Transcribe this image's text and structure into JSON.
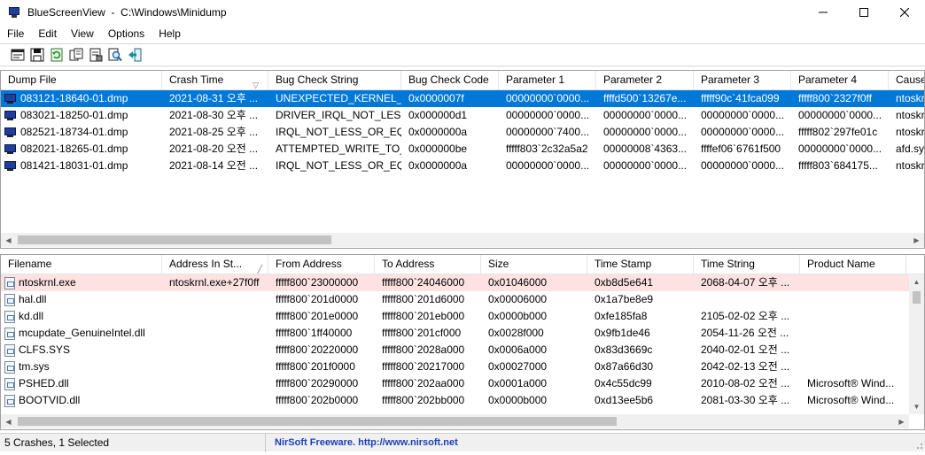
{
  "window": {
    "title": "BlueScreenView  -  C:\\Windows\\Minidump",
    "icon": "bluescreen-monitor-icon"
  },
  "menu": [
    "File",
    "Edit",
    "View",
    "Options",
    "Help"
  ],
  "toolbar": [
    "html-report-icon",
    "save-icon",
    "refresh-icon",
    "copy-icon",
    "properties-icon",
    "find-icon",
    "exit-icon"
  ],
  "crash_list": {
    "columns": [
      {
        "label": "Dump File"
      },
      {
        "label": "Crash Time",
        "sort": "desc"
      },
      {
        "label": "Bug Check String"
      },
      {
        "label": "Bug Check Code"
      },
      {
        "label": "Parameter 1"
      },
      {
        "label": "Parameter 2"
      },
      {
        "label": "Parameter 3"
      },
      {
        "label": "Parameter 4"
      },
      {
        "label": "Caused"
      }
    ],
    "rows": [
      {
        "selected": true,
        "cells": [
          "083121-18640-01.dmp",
          "2021-08-31 오후 ...",
          "UNEXPECTED_KERNEL_...",
          "0x0000007f",
          "00000000`0000...",
          "ffffd500`13267e...",
          "fffff90c`41fca099",
          "fffff800`2327f0ff",
          "ntoskrn"
        ]
      },
      {
        "selected": false,
        "cells": [
          "083021-18250-01.dmp",
          "2021-08-30 오후 ...",
          "DRIVER_IRQL_NOT_LES...",
          "0x000000d1",
          "00000000`0000...",
          "00000000`0000...",
          "00000000`0000...",
          "00000000`0000...",
          "ntoskrn"
        ]
      },
      {
        "selected": false,
        "cells": [
          "082521-18734-01.dmp",
          "2021-08-25 오후 ...",
          "IRQL_NOT_LESS_OR_EQ...",
          "0x0000000a",
          "00000000`7400...",
          "00000000`0000...",
          "00000000`0000...",
          "fffff802`297fe01c",
          "ntoskrn"
        ]
      },
      {
        "selected": false,
        "cells": [
          "082021-18265-01.dmp",
          "2021-08-20 오전 ...",
          "ATTEMPTED_WRITE_TO_...",
          "0x000000be",
          "fffff803`2c32a5a2",
          "00000008`4363...",
          "ffffef06`6761f500",
          "00000000`0000...",
          "afd.sys"
        ]
      },
      {
        "selected": false,
        "cells": [
          "081421-18031-01.dmp",
          "2021-08-14 오전 ...",
          "IRQL_NOT_LESS_OR_EQ...",
          "0x0000000a",
          "00000000`0000...",
          "00000000`0000...",
          "00000000`0000...",
          "fffff803`684175...",
          "ntoskrn"
        ]
      }
    ]
  },
  "driver_list": {
    "columns": [
      {
        "label": "Filename"
      },
      {
        "label": "Address In St...",
        "sort": "asc"
      },
      {
        "label": "From Address"
      },
      {
        "label": "To Address"
      },
      {
        "label": "Size"
      },
      {
        "label": "Time Stamp"
      },
      {
        "label": "Time String"
      },
      {
        "label": "Product Name"
      }
    ],
    "rows": [
      {
        "highlight": true,
        "cells": [
          "ntoskrnl.exe",
          "ntoskrnl.exe+27f0ff",
          "fffff800`23000000",
          "fffff800`24046000",
          "0x01046000",
          "0xb8d5e641",
          "2068-04-07 오후 ...",
          ""
        ]
      },
      {
        "highlight": false,
        "cells": [
          "hal.dll",
          "",
          "fffff800`201d0000",
          "fffff800`201d6000",
          "0x00006000",
          "0x1a7be8e9",
          "",
          ""
        ]
      },
      {
        "highlight": false,
        "cells": [
          "kd.dll",
          "",
          "fffff800`201e0000",
          "fffff800`201eb000",
          "0x0000b000",
          "0xfe185fa8",
          "2105-02-02 오후 ...",
          ""
        ]
      },
      {
        "highlight": false,
        "cells": [
          "mcupdate_GenuineIntel.dll",
          "",
          "fffff800`1ff40000",
          "fffff800`201cf000",
          "0x0028f000",
          "0x9fb1de46",
          "2054-11-26 오전 ...",
          ""
        ]
      },
      {
        "highlight": false,
        "cells": [
          "CLFS.SYS",
          "",
          "fffff800`20220000",
          "fffff800`2028a000",
          "0x0006a000",
          "0x83d3669c",
          "2040-02-01 오전 ...",
          ""
        ]
      },
      {
        "highlight": false,
        "cells": [
          "tm.sys",
          "",
          "fffff800`201f0000",
          "fffff800`20217000",
          "0x00027000",
          "0x87a66d30",
          "2042-02-13 오전 ...",
          ""
        ]
      },
      {
        "highlight": false,
        "cells": [
          "PSHED.dll",
          "",
          "fffff800`20290000",
          "fffff800`202aa000",
          "0x0001a000",
          "0x4c55dc99",
          "2010-08-02 오전 ...",
          "Microsoft® Wind..."
        ]
      },
      {
        "highlight": false,
        "cells": [
          "BOOTVID.dll",
          "",
          "fffff800`202b0000",
          "fffff800`202bb000",
          "0x0000b000",
          "0xd13ee5b6",
          "2081-03-30 오후 ...",
          "Microsoft® Wind..."
        ]
      }
    ]
  },
  "status": {
    "count": "5 Crashes, 1 Selected",
    "link": "NirSoft Freeware.  http://www.nirsoft.net"
  },
  "colors": {
    "selection": "#0078d7",
    "highlight_row": "#fde2e2",
    "link": "#1a3fb8"
  }
}
